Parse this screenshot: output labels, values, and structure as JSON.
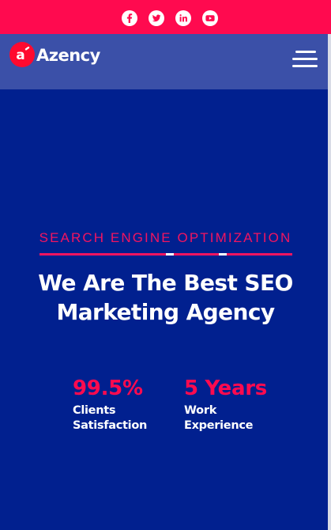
{
  "colors": {
    "accent": "#ff0a4f",
    "header_bg": "#3b50a8",
    "hero_bg": "#01208f",
    "text": "#ffffff"
  },
  "topbar": {
    "social": [
      {
        "icon": "facebook-icon"
      },
      {
        "icon": "twitter-icon"
      },
      {
        "icon": "linkedin-icon"
      },
      {
        "icon": "youtube-icon"
      }
    ]
  },
  "header": {
    "logo_mark": "a",
    "logo_text": "Azency",
    "menu_icon": "hamburger-menu-icon"
  },
  "hero": {
    "eyebrow": "SEARCH ENGINE OPTIMIZATION",
    "headline_line1": "We Are The Best SEO",
    "headline_line2": "Marketing Agency",
    "stats": [
      {
        "value": "99.5%",
        "label_line1": "Clients",
        "label_line2": "Satisfaction"
      },
      {
        "value": "5 Years",
        "label_line1": "Work",
        "label_line2": "Experience"
      }
    ]
  }
}
